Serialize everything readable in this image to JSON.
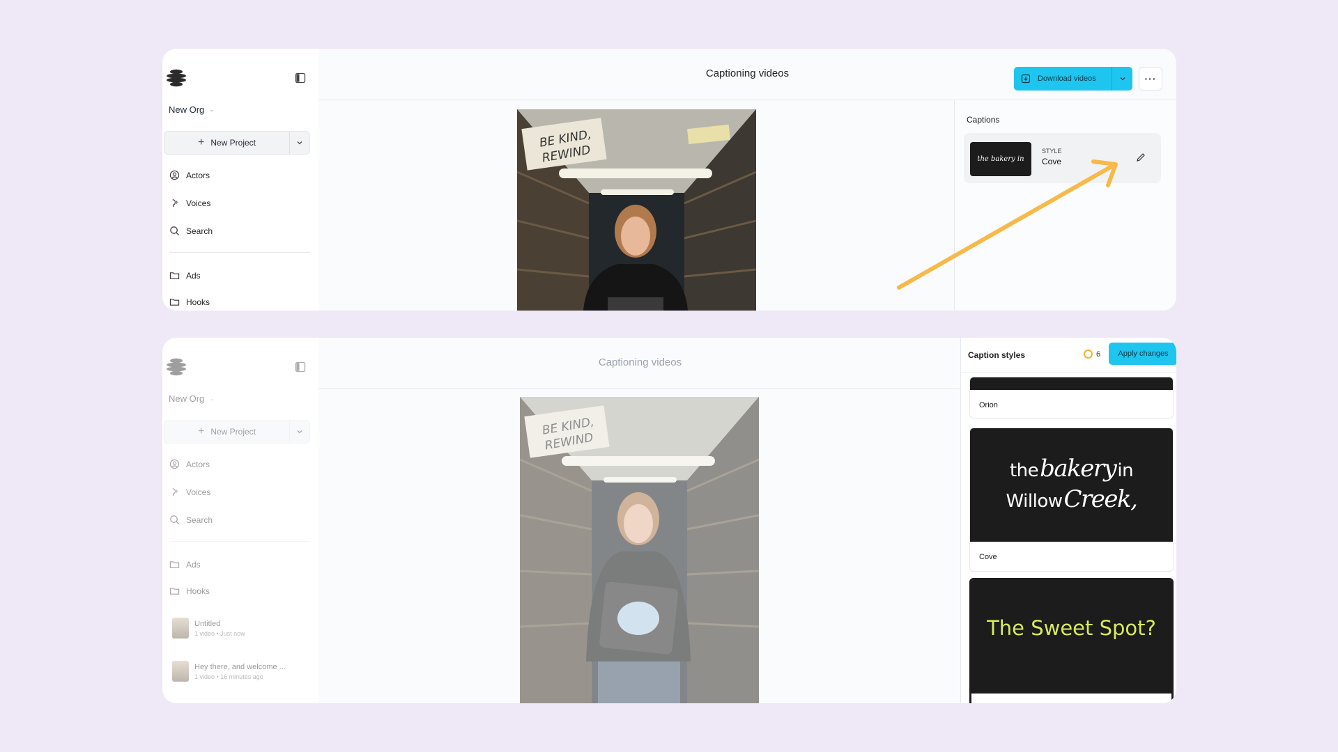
{
  "top": {
    "sidebar": {
      "org_name": "New Org",
      "new_project": "New Project",
      "nav": [
        {
          "label": "Actors"
        },
        {
          "label": "Voices"
        },
        {
          "label": "Search"
        },
        {
          "label": "Ads"
        },
        {
          "label": "Hooks"
        }
      ]
    },
    "header": {
      "title": "Captioning videos",
      "download_label": "Download videos"
    },
    "captions": {
      "section_label": "Captions",
      "thumb_text": "the bakery in",
      "style_label": "STYLE",
      "style_name": "Cove"
    },
    "video": {
      "sign_line1": "BE KIND,",
      "sign_line2": "REWIND"
    }
  },
  "bottom": {
    "sidebar": {
      "org_name": "New Org",
      "new_project": "New Project",
      "nav": [
        {
          "label": "Actors"
        },
        {
          "label": "Voices"
        },
        {
          "label": "Search"
        },
        {
          "label": "Ads"
        },
        {
          "label": "Hooks"
        }
      ],
      "recent": [
        {
          "title": "Untitled",
          "meta": "1 video • Just now"
        },
        {
          "title": "Hey there, and welcome ...",
          "meta": "1 video • 16 minutes ago"
        }
      ]
    },
    "header": {
      "title": "Captioning videos"
    },
    "styles_panel": {
      "title": "Caption styles",
      "credits": "6",
      "apply_label": "Apply changes",
      "styles": [
        {
          "name": "Orion"
        },
        {
          "name": "Cove",
          "preview_line1a": "the",
          "preview_line1b": "bakery",
          "preview_line1c": "in",
          "preview_line2a": "Willow",
          "preview_line2b": "Creek,"
        },
        {
          "name": "",
          "preview_text": "The Sweet Spot?"
        }
      ]
    },
    "video": {
      "sign_line1": "BE KIND,",
      "sign_line2": "REWIND"
    }
  },
  "colors": {
    "accent": "#1ec5ee",
    "background": "#efe8f7",
    "arrow": "#f6b94a"
  }
}
